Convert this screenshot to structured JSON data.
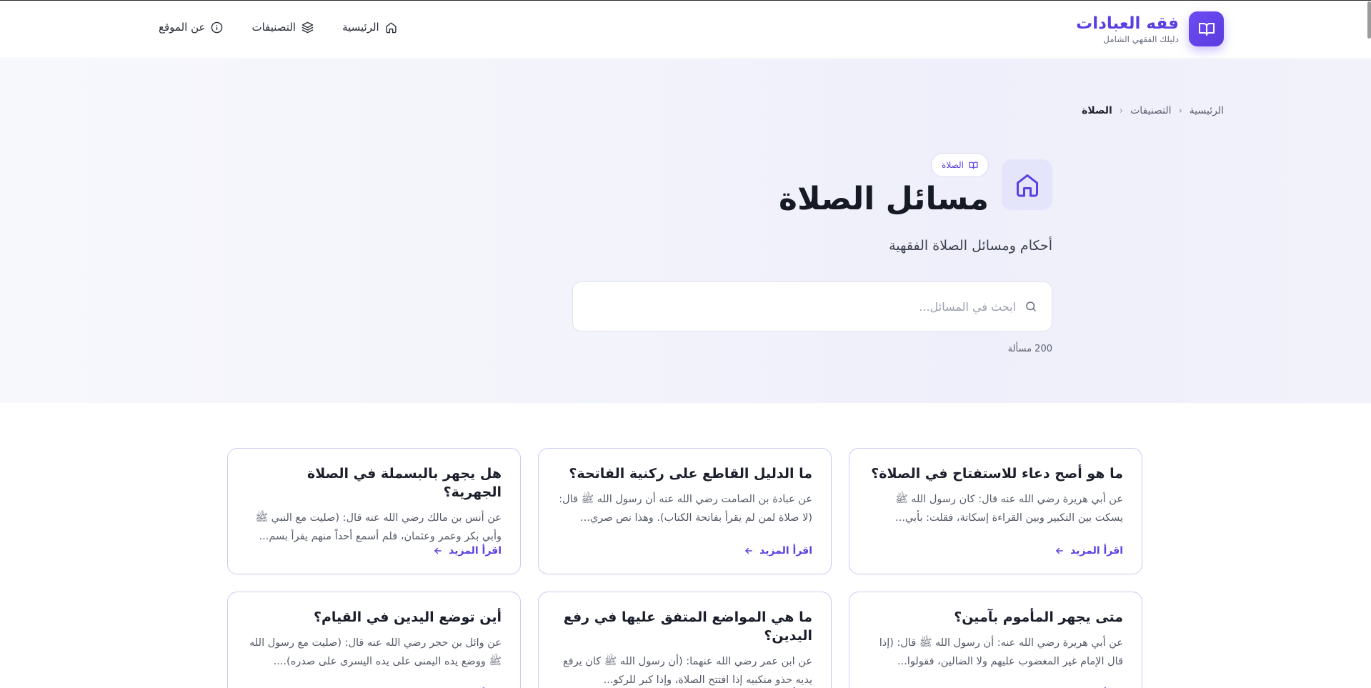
{
  "brand": {
    "title": "فقه العبادات",
    "subtitle": "دليلك الفقهي الشامل",
    "logo_icon": "book-open-icon"
  },
  "nav": [
    {
      "label": "الرئيسية",
      "icon": "home-icon"
    },
    {
      "label": "التصنيفات",
      "icon": "layers-icon"
    },
    {
      "label": "عن الموقع",
      "icon": "info-icon"
    }
  ],
  "breadcrumb": [
    "الرئيسية",
    "التصنيفات",
    "الصلاة"
  ],
  "category": {
    "tag": "الصلاة",
    "title": "مسائل الصلاة",
    "subtitle": "أحكام ومسائل الصلاة الفقهية",
    "icon": "home-icon"
  },
  "search": {
    "placeholder": "ابحث في المسائل...",
    "value": ""
  },
  "count": "200 مسألة",
  "read_more_label": "اقرأ المزيد",
  "cards": [
    {
      "title": "ما هو أصح دعاء للاستفتاح في الصلاة؟",
      "text": "عن أبي هريرة رضي الله عنه قال: كان رسول الله ﷺ يسكت بين التكبير وبين القراءة إسكاتة، فقلت: بأبي..."
    },
    {
      "title": "ما الدليل القاطع على ركنية الفاتحة؟",
      "text": "عن عبادة بن الصامت رضي الله عنه أن رسول الله ﷺ قال: (لا صلاة لمن لم يقرأ بفاتحة الكتاب). وهذا نص صري..."
    },
    {
      "title": "هل يجهر بالبسملة في الصلاة الجهرية؟",
      "text": "عن أنس بن مالك رضي الله عنه قال: (صليت مع النبي ﷺ وأبي بكر وعمر وعثمان، فلم أسمع أحداً منهم يقرأ بسم..."
    },
    {
      "title": "متى يجهر المأموم بآمين؟",
      "text": "عن أبي هريرة رضي الله عنه: أن رسول الله ﷺ قال: (إذا قال الإمام غير المغضوب عليهم ولا الضالين، فقولوا..."
    },
    {
      "title": "ما هي المواضع المتفق عليها في رفع اليدين؟",
      "text": "عن ابن عمر رضي الله عنهما: (أن رسول الله ﷺ كان يرفع يديه حذو منكبيه إذا افتتح الصلاة، وإذا كبر للركو..."
    },
    {
      "title": "أين توضع اليدين في القيام؟",
      "text": "عن وائل بن حجر رضي الله عنه قال: (صليت مع رسول الله ﷺ ووضع يده اليمنى على يده اليسرى على صدره)...."
    }
  ]
}
